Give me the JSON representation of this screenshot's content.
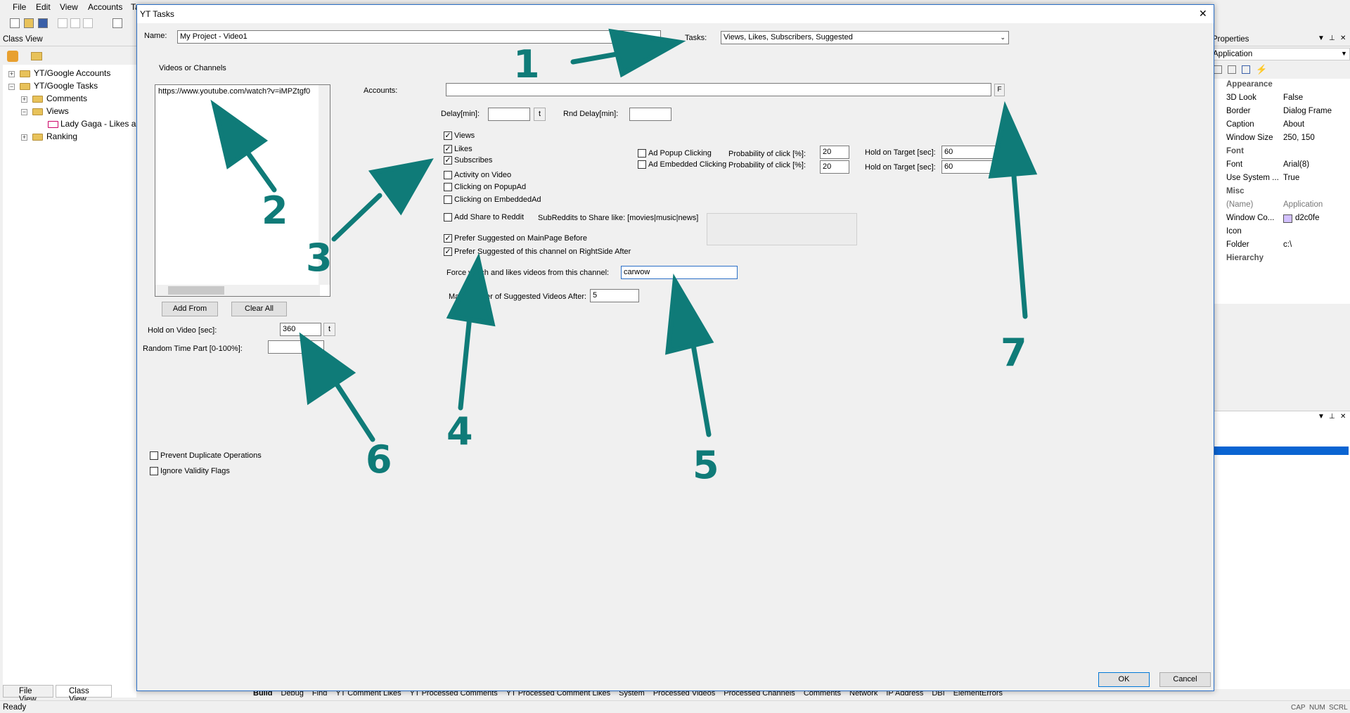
{
  "menu": {
    "file": "File",
    "edit": "Edit",
    "view": "View",
    "accounts": "Accounts",
    "t": "Ta"
  },
  "classview": {
    "title": "Class View",
    "items": [
      "YT/Google Accounts",
      "YT/Google Tasks",
      "Comments",
      "Views",
      "Lady Gaga - Likes an",
      "Ranking"
    ]
  },
  "bottom_tabs": {
    "fileview": "File View",
    "classview": "Class View",
    "tabs": [
      "Build",
      "Debug",
      "Find",
      "YT Comment Likes",
      "YT Processed Comments",
      "YT Processed Comment Likes",
      "System",
      "Processed Videos",
      "Processed Channels",
      "Comments",
      "Network",
      "IP Address",
      "DBI",
      "ElementErrors"
    ]
  },
  "status": {
    "left": "Ready",
    "cap": "CAP",
    "num": "NUM",
    "scrl": "SCRL"
  },
  "properties": {
    "title": "Properties",
    "object": "Application",
    "rows": [
      {
        "k": "Appearance",
        "cat": true
      },
      {
        "k": "3D Look",
        "v": "False"
      },
      {
        "k": "Border",
        "v": "Dialog Frame"
      },
      {
        "k": "Caption",
        "v": "About"
      },
      {
        "k": "Window Size",
        "v": "250, 150"
      },
      {
        "k": "Font",
        "cat": true
      },
      {
        "k": "Font",
        "v": "Arial(8)"
      },
      {
        "k": "Use System ...",
        "v": "True"
      },
      {
        "k": "Misc",
        "cat": true
      },
      {
        "k": "(Name)",
        "v": "Application"
      },
      {
        "k": "Window Co...",
        "v": "d2c0fe"
      },
      {
        "k": "Icon",
        "v": ""
      },
      {
        "k": "Folder",
        "v": "c:\\"
      },
      {
        "k": "Hierarchy",
        "cat": true
      }
    ],
    "swatch_color": "#d2c0fe"
  },
  "dialog": {
    "title": "YT Tasks",
    "close": "✕",
    "name_label": "Name:",
    "name_value": "My Project - Video1",
    "tasks_label": "Tasks:",
    "tasks_value": "Views, Likes, Subscribers, Suggested",
    "videos_label": "Videos or Channels",
    "videos_value": "https://www.youtube.com/watch?v=iMPZtgf0",
    "accounts_label": "Accounts:",
    "f_button": "F",
    "delay_label": "Delay[min]:",
    "t_button": "t",
    "rnd_delay_label": "Rnd Delay[min]:",
    "checks": {
      "views": "Views",
      "likes": "Likes",
      "subscribes": "Subscribes",
      "activity": "Activity on Video",
      "popupad": "Clicking on PopupAd",
      "embeddedad": "Clicking on EmbeddedAd",
      "reddit": "Add Share to Reddit",
      "prefer_main": "Prefer Suggested on MainPage Before",
      "prefer_right": "Prefer Suggested of this channel on RightSide After",
      "ad_popup": "Ad Popup Clicking",
      "ad_embedded": "Ad Embedded Clicking",
      "prevent_dup": "Prevent Duplicate Operations",
      "ignore_validity": "Ignore Validity Flags"
    },
    "prob_label": "Probability of click [%]:",
    "prob1": "20",
    "prob2": "20",
    "hold_target_label": "Hold on Target [sec]:",
    "hold1": "60",
    "hold2": "60",
    "subreddits_label": "SubReddits to Share like: [movies|music|news]",
    "force_label": "Force watch and likes videos from this channel:",
    "force_value": "carwow",
    "max_label": "Max Number of Suggested Videos After:",
    "max_value": "5",
    "add_from": "Add From",
    "clear_all": "Clear All",
    "hold_video_label": "Hold on Video [sec]:",
    "hold_video_value": "360",
    "random_label": "Random  Time Part  [0-100%]:",
    "ok": "OK",
    "cancel": "Cancel"
  },
  "annotations": [
    "1",
    "2",
    "3",
    "4",
    "5",
    "6",
    "7"
  ],
  "accent_color": "#0f7b78"
}
